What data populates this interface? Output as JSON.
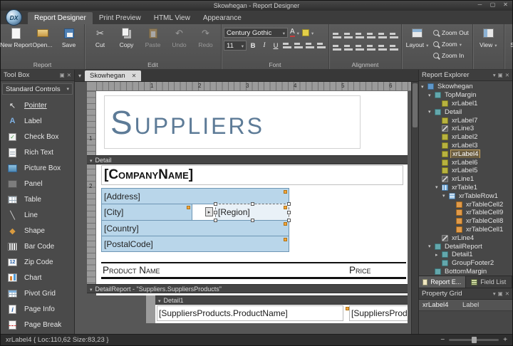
{
  "window": {
    "title": "Skowhegan - Report Designer",
    "logo_text": "DX",
    "controls": {
      "minimize": "─",
      "maximize": "▢",
      "close": "✕"
    }
  },
  "ribbon": {
    "tabs": [
      "Report Designer",
      "Print Preview",
      "HTML View",
      "Appearance"
    ],
    "report_group": {
      "label": "Report",
      "new_report": "New Report",
      "open": "Open...",
      "save": "Save"
    },
    "edit_group": {
      "label": "Edit",
      "cut": "Cut",
      "copy": "Copy",
      "paste": "Paste",
      "undo": "Undo",
      "redo": "Redo"
    },
    "font_group": {
      "label": "Font",
      "font_name": "Century Gothic",
      "font_size": "11",
      "bold": "B",
      "italic": "I",
      "underline": "U"
    },
    "alignment_group": {
      "label": "Alignment"
    },
    "layout_button": "Layout",
    "zoom_buttons": {
      "zoom_out": "Zoom Out",
      "zoom": "Zoom",
      "zoom_in": "Zoom In"
    },
    "view_button": "View",
    "scripts_button": "Scripts"
  },
  "toolbox": {
    "title": "Tool Box",
    "category": "Standard Controls",
    "items": [
      {
        "label": "Pointer",
        "icon": "pointer-icon",
        "selected": true
      },
      {
        "label": "Label",
        "icon": "label-icon"
      },
      {
        "label": "Check Box",
        "icon": "checkbox-icon"
      },
      {
        "label": "Rich Text",
        "icon": "richtext-icon"
      },
      {
        "label": "Picture Box",
        "icon": "picturebox-icon"
      },
      {
        "label": "Panel",
        "icon": "panel-icon"
      },
      {
        "label": "Table",
        "icon": "table-icon"
      },
      {
        "label": "Line",
        "icon": "line-icon"
      },
      {
        "label": "Shape",
        "icon": "shape-icon"
      },
      {
        "label": "Bar Code",
        "icon": "barcode-icon"
      },
      {
        "label": "Zip Code",
        "icon": "zipcode-icon"
      },
      {
        "label": "Chart",
        "icon": "chart-icon"
      },
      {
        "label": "Pivot Grid",
        "icon": "pivotgrid-icon"
      },
      {
        "label": "Page Info",
        "icon": "pageinfo-icon"
      },
      {
        "label": "Page Break",
        "icon": "pagebreak-icon"
      }
    ]
  },
  "document": {
    "tab_label": "Skowhegan",
    "tab_close": "✕",
    "h_ruler": [
      "1",
      "2",
      "3",
      "4",
      "5",
      "6"
    ],
    "v_ruler": [
      "1",
      "2"
    ]
  },
  "design": {
    "title_label": "Suppliers",
    "detail_band": "Detail",
    "company_label": "[CompanyName]",
    "table_cells": {
      "address": "[Address]",
      "city": "[City]",
      "region": "[Region]",
      "country": "[Country]",
      "postal_code": "[PostalCode]"
    },
    "column_headers": {
      "product": "Product Name",
      "price": "Price"
    },
    "detail_report_band": "DetailReport - \"Suppliers.SuppliersProducts\"",
    "detail1_band": "Detail1",
    "field_labels": {
      "product_name": "[SuppliersProducts.ProductName]",
      "price_clipped": "[SuppliersProd"
    }
  },
  "report_explorer": {
    "title": "Report Explorer",
    "tree": [
      {
        "label": "Skowhegan",
        "level": 0,
        "icon": "report-icon",
        "expanded": true
      },
      {
        "label": "TopMargin",
        "level": 1,
        "icon": "band-icon",
        "expanded": true
      },
      {
        "label": "xrLabel1",
        "level": 2,
        "icon": "label-icon"
      },
      {
        "label": "Detail",
        "level": 1,
        "icon": "band-icon",
        "expanded": true
      },
      {
        "label": "xrLabel7",
        "level": 2,
        "icon": "label-icon"
      },
      {
        "label": "xrLine3",
        "level": 2,
        "icon": "line-icon"
      },
      {
        "label": "xrLabel2",
        "level": 2,
        "icon": "label-icon"
      },
      {
        "label": "xrLabel3",
        "level": 2,
        "icon": "label-icon"
      },
      {
        "label": "xrLabel4",
        "level": 2,
        "icon": "label-icon",
        "selected": true
      },
      {
        "label": "xrLabel6",
        "level": 2,
        "icon": "label-icon"
      },
      {
        "label": "xrLabel5",
        "level": 2,
        "icon": "label-icon"
      },
      {
        "label": "xrLine1",
        "level": 2,
        "icon": "line-icon"
      },
      {
        "label": "xrTable1",
        "level": 2,
        "icon": "table-icon",
        "expanded": true
      },
      {
        "label": "xrTableRow1",
        "level": 3,
        "icon": "table-row-icon",
        "expanded": true
      },
      {
        "label": "xrTableCell2",
        "level": 4,
        "icon": "table-cell-icon"
      },
      {
        "label": "xrTableCell9",
        "level": 4,
        "icon": "table-cell-icon"
      },
      {
        "label": "xrTableCell8",
        "level": 4,
        "icon": "table-cell-icon"
      },
      {
        "label": "xrTableCell1",
        "level": 4,
        "icon": "table-cell-icon"
      },
      {
        "label": "xrLine4",
        "level": 2,
        "icon": "line-icon"
      },
      {
        "label": "DetailReport",
        "level": 1,
        "icon": "band-icon",
        "expanded": true
      },
      {
        "label": "Detail1",
        "level": 2,
        "icon": "band-icon",
        "expanded": false
      },
      {
        "label": "GroupFooter2",
        "level": 2,
        "icon": "band-icon"
      },
      {
        "label": "BottomMargin",
        "level": 1,
        "icon": "band-icon"
      }
    ],
    "tabs": [
      {
        "label": "Report E...",
        "active": true
      },
      {
        "label": "Field List",
        "active": false
      }
    ]
  },
  "property_grid": {
    "title": "Property Grid",
    "object_name": "xrLabel4",
    "object_type": "Label"
  },
  "status_bar": {
    "selection_info": "xrLabel4 { Loc:110,62 Size:83,23 }",
    "zoom_out": "−",
    "zoom_in": "+"
  }
}
